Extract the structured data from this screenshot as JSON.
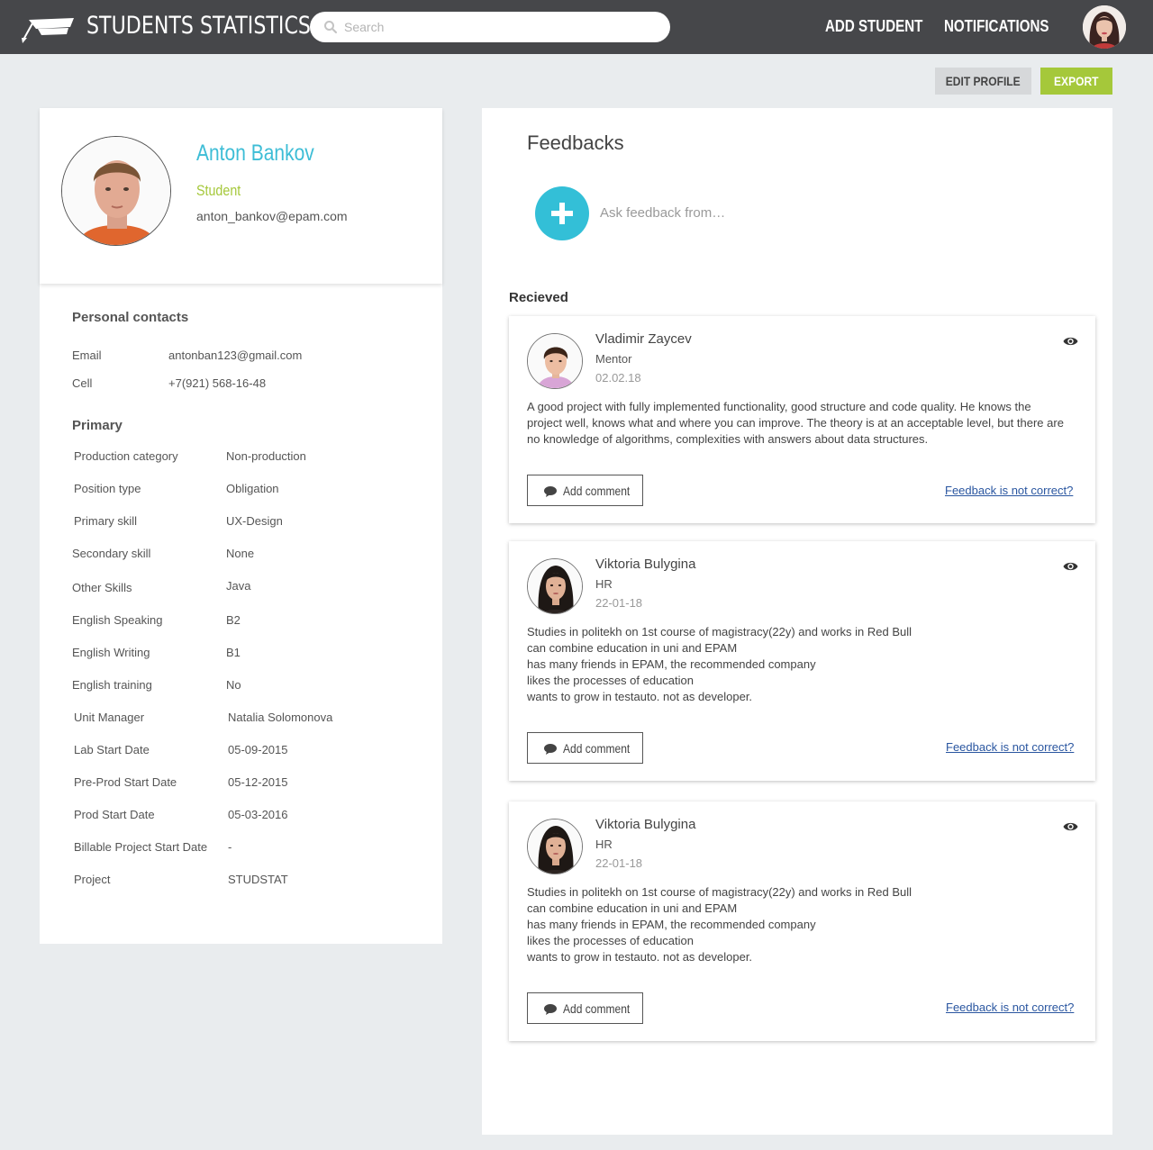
{
  "header": {
    "title": "STUDENTS STATISTICS",
    "search_placeholder": "Search",
    "nav": {
      "add_student": "ADD STUDENT",
      "notifications": "NOTIFICATIONS"
    }
  },
  "actions": {
    "edit_profile": "EDIT PROFILE",
    "export": "EXPORT"
  },
  "profile": {
    "name": "Anton Bankov",
    "role": "Student",
    "email": "anton_bankov@epam.com",
    "personal_contacts_title": "Personal contacts",
    "contacts": [
      {
        "label": "Email",
        "value": "antonban123@gmail.com"
      },
      {
        "label": "Cell",
        "value": "+7(921) 568-16-48"
      }
    ],
    "primary_title": "Primary",
    "primary": [
      {
        "label": "Production category",
        "value": "Non-production"
      },
      {
        "label": "Position type",
        "value": "Obligation"
      },
      {
        "label": "Primary skill",
        "value": "UX-Design"
      },
      {
        "label": "Secondary skill",
        "value": "None"
      },
      {
        "label": "Other Skills",
        "value": "Java"
      },
      {
        "label": "English Speaking",
        "value": "B2"
      },
      {
        "label": "English Writing",
        "value": "B1"
      },
      {
        "label": "English training",
        "value": "No"
      },
      {
        "label": "Unit Manager",
        "value": "Natalia Solomonova"
      },
      {
        "label": "Lab Start Date",
        "value": "05-09-2015"
      },
      {
        "label": "Pre-Prod Start Date",
        "value": "05-12-2015"
      },
      {
        "label": "Prod Start Date",
        "value": "05-03-2016"
      },
      {
        "label": "Billable Project Start Date",
        "value": "-"
      },
      {
        "label": "Project",
        "value": "STUDSTAT"
      }
    ]
  },
  "feedbacks": {
    "title": "Feedbacks",
    "ask_placeholder": "Ask feedback from…",
    "received_label": "Recieved",
    "items": [
      {
        "name": "Vladimir Zaycev",
        "role": "Mentor",
        "date": "02.02.18",
        "text": "A good project with fully implemented functionality, good structure and code quality. He knows the project well, knows what and where you can improve. The theory is at an acceptable level, but there are no knowledge of algorithms, complexities with answers about data structures.",
        "add_comment": "Add comment",
        "not_correct": "Feedback is not correct?"
      },
      {
        "name": "Viktoria Bulygina",
        "role": "HR",
        "date": "22-01-18",
        "text": "Studies in politekh on 1st course of magistracy(22y) and works in Red Bull\ncan combine education in uni and EPAM\nhas many friends in EPAM, the recommended company\nlikes the processes of education\nwants to grow in testauto. not as developer.",
        "add_comment": "Add comment",
        "not_correct": "Feedback is not correct?"
      },
      {
        "name": "Viktoria Bulygina",
        "role": "HR",
        "date": "22-01-18",
        "text": "Studies in politekh on 1st course of magistracy(22y) and works in Red Bull\ncan combine education in uni and EPAM\nhas many friends in EPAM, the recommended company\nlikes the processes of education\nwants to grow in testauto. not as developer.",
        "add_comment": "Add comment",
        "not_correct": "Feedback is not correct?"
      }
    ]
  },
  "icons": {
    "logo": "graduation-cap-icon",
    "search": "search-icon",
    "add": "plus-icon",
    "view": "eye-icon",
    "comment": "chat-bubble-icon"
  },
  "colors": {
    "topbar": "#46474a",
    "accent_blue": "#33bfd7",
    "accent_green": "#a5c83a",
    "link": "#2a56a0",
    "background": "#e9ecee"
  }
}
